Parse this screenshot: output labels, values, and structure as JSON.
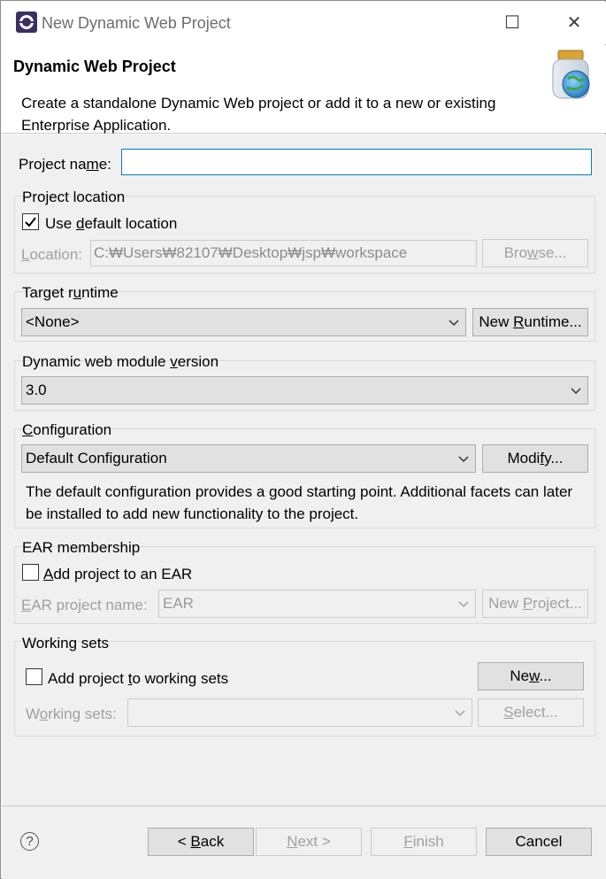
{
  "window": {
    "title": "New Dynamic Web Project",
    "minimize_glyph": "—",
    "maximize_glyph": "☐",
    "close_glyph": "✕"
  },
  "banner": {
    "title": "Dynamic Web Project",
    "description": "Create a standalone Dynamic Web project or add it to a new or existing Enterprise Application."
  },
  "project_name": {
    "label_pre": "Project na",
    "label_u": "m",
    "label_post": "e:",
    "value": ""
  },
  "project_location": {
    "group_title": "Project location",
    "use_default_pre": "Use ",
    "use_default_u": "d",
    "use_default_post": "efault location",
    "use_default_checked": true,
    "location_label_u": "L",
    "location_label_post": "ocation:",
    "location_value": "C:₩Users₩82107₩Desktop₩jsp₩workspace",
    "browse_pre": "Bro",
    "browse_u": "w",
    "browse_post": "se..."
  },
  "target_runtime": {
    "group_title_pre": "Target r",
    "group_title_u": "u",
    "group_title_post": "ntime",
    "selected": "<None>",
    "new_runtime_pre": "New ",
    "new_runtime_u": "R",
    "new_runtime_post": "untime..."
  },
  "module_version": {
    "group_title_pre": "Dynamic web module ",
    "group_title_u": "v",
    "group_title_post": "ersion",
    "selected": "3.0"
  },
  "configuration": {
    "group_title_u": "C",
    "group_title_post": "onfiguration",
    "selected": "Default Configuration",
    "modify_pre": "Modi",
    "modify_u": "f",
    "modify_post": "y...",
    "description": "The default configuration provides a good starting point. Additional facets can later be installed to add new functionality to the project."
  },
  "ear": {
    "group_title": "EAR membership",
    "add_u": "A",
    "add_post": "dd project to an EAR",
    "add_checked": false,
    "name_label_u": "E",
    "name_label_post": "AR project name:",
    "name_value": "EAR",
    "new_project_pre": "New ",
    "new_project_u": "P",
    "new_project_post": "roject..."
  },
  "working_sets": {
    "group_title": "Working sets",
    "add_pre": "Add project ",
    "add_u": "t",
    "add_post": "o working sets",
    "add_checked": false,
    "new_pre": "Ne",
    "new_u": "w",
    "new_post": "...",
    "sets_label_pre": "W",
    "sets_label_u": "o",
    "sets_label_post": "rking sets:",
    "select_pre": "",
    "select_u": "S",
    "select_post": "elect..."
  },
  "footer": {
    "help_glyph": "?",
    "back_pre": "< ",
    "back_u": "B",
    "back_post": "ack",
    "next_u": "N",
    "next_post": "ext >",
    "finish_u": "F",
    "finish_post": "inish",
    "cancel": "Cancel"
  }
}
